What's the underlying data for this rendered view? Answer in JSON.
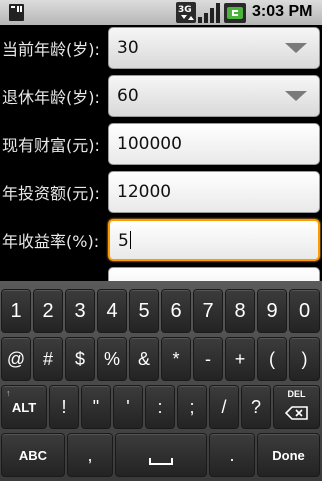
{
  "status_bar": {
    "time": "3:03 PM",
    "network_label": "3G",
    "icons": [
      "sd-card-icon",
      "network-3g-icon",
      "signal-icon",
      "battery-icon"
    ]
  },
  "form": {
    "rows": [
      {
        "label": "当前年龄(岁):",
        "value": "30",
        "type": "spinner"
      },
      {
        "label": "退休年龄(岁):",
        "value": "60",
        "type": "spinner"
      },
      {
        "label": "现有财富(元):",
        "value": "100000",
        "type": "text"
      },
      {
        "label": "年投资额(元):",
        "value": "12000",
        "type": "text"
      },
      {
        "label": "年收益率(%):",
        "value": "5",
        "type": "text",
        "focused": true
      }
    ]
  },
  "keyboard": {
    "row1": [
      "1",
      "2",
      "3",
      "4",
      "5",
      "6",
      "7",
      "8",
      "9",
      "0"
    ],
    "row2": [
      "@",
      "#",
      "$",
      "%",
      "&",
      "*",
      "-",
      "+",
      "(",
      ")"
    ],
    "row3": [
      "ALT",
      "!",
      "\"",
      "'",
      ":",
      ";",
      "/",
      "?",
      "DEL"
    ],
    "row4": [
      "ABC",
      ",",
      "␣",
      ".",
      "Done"
    ],
    "alt_hint": "↑",
    "colors": {
      "key": "#2d2d2d",
      "background": "#4a4a4a",
      "focus": "#ff9a00"
    }
  }
}
